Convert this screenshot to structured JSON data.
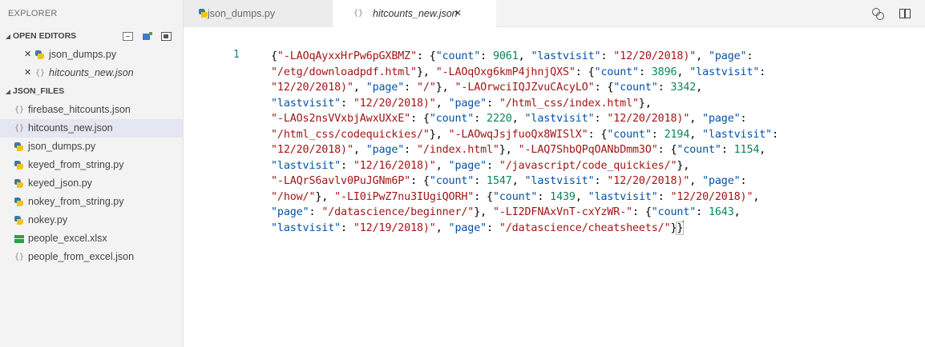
{
  "sidebar": {
    "title": "EXPLORER",
    "open_editors": {
      "label": "OPEN EDITORS",
      "items": [
        {
          "label": "json_dumps.py",
          "icon": "python-icon"
        },
        {
          "label": "hitcounts_new.json",
          "icon": "json-icon"
        }
      ]
    },
    "folder": {
      "label": "JSON_FILES",
      "items": [
        {
          "label": "firebase_hitcounts.json",
          "icon": "json-icon"
        },
        {
          "label": "hitcounts_new.json",
          "icon": "json-icon"
        },
        {
          "label": "json_dumps.py",
          "icon": "python-icon"
        },
        {
          "label": "keyed_from_string.py",
          "icon": "python-icon"
        },
        {
          "label": "keyed_json.py",
          "icon": "python-icon"
        },
        {
          "label": "nokey_from_string.py",
          "icon": "python-icon"
        },
        {
          "label": "nokey.py",
          "icon": "python-icon"
        },
        {
          "label": "people_excel.xlsx",
          "icon": "excel-icon"
        },
        {
          "label": "people_from_excel.json",
          "icon": "json-icon"
        }
      ]
    }
  },
  "tabs": [
    {
      "label": "json_dumps.py",
      "active": false
    },
    {
      "label": "hitcounts_new.json",
      "active": true,
      "close": "✕"
    }
  ],
  "editor": {
    "line_number": "1",
    "lines": [
      [
        [
          "p",
          "{"
        ],
        [
          "s",
          "\"-LAOqAyxxHrPw6pGXBMZ\""
        ],
        [
          "p",
          ": {"
        ],
        [
          "k",
          "\"count\""
        ],
        [
          "p",
          ": "
        ],
        [
          "n",
          "9061"
        ],
        [
          "p",
          ", "
        ],
        [
          "k",
          "\"lastvisit\""
        ],
        [
          "p",
          ": "
        ],
        [
          "s",
          "\"12/20/2018)\""
        ],
        [
          "p",
          ", "
        ],
        [
          "k",
          "\"page\""
        ],
        [
          "p",
          ":"
        ]
      ],
      [
        [
          "s",
          "\"/etg/downloadpdf.html\""
        ],
        [
          "p",
          "}, "
        ],
        [
          "s",
          "\"-LAOqOxg6kmP4jhnjQXS\""
        ],
        [
          "p",
          ": {"
        ],
        [
          "k",
          "\"count\""
        ],
        [
          "p",
          ": "
        ],
        [
          "n",
          "3896"
        ],
        [
          "p",
          ", "
        ],
        [
          "k",
          "\"lastvisit\""
        ],
        [
          "p",
          ":"
        ]
      ],
      [
        [
          "s",
          "\"12/20/2018)\""
        ],
        [
          "p",
          ", "
        ],
        [
          "k",
          "\"page\""
        ],
        [
          "p",
          ": "
        ],
        [
          "s",
          "\"/\""
        ],
        [
          "p",
          "}, "
        ],
        [
          "s",
          "\"-LAOrwciIQJZvuCAcyLO\""
        ],
        [
          "p",
          ": {"
        ],
        [
          "k",
          "\"count\""
        ],
        [
          "p",
          ": "
        ],
        [
          "n",
          "3342"
        ],
        [
          "p",
          ","
        ]
      ],
      [
        [
          "k",
          "\"lastvisit\""
        ],
        [
          "p",
          ": "
        ],
        [
          "s",
          "\"12/20/2018)\""
        ],
        [
          "p",
          ", "
        ],
        [
          "k",
          "\"page\""
        ],
        [
          "p",
          ": "
        ],
        [
          "s",
          "\"/html_css/index.html\""
        ],
        [
          "p",
          "},"
        ]
      ],
      [
        [
          "s",
          "\"-LAOs2nsVVxbjAwxUXxE\""
        ],
        [
          "p",
          ": {"
        ],
        [
          "k",
          "\"count\""
        ],
        [
          "p",
          ": "
        ],
        [
          "n",
          "2220"
        ],
        [
          "p",
          ", "
        ],
        [
          "k",
          "\"lastvisit\""
        ],
        [
          "p",
          ": "
        ],
        [
          "s",
          "\"12/20/2018)\""
        ],
        [
          "p",
          ", "
        ],
        [
          "k",
          "\"page\""
        ],
        [
          "p",
          ":"
        ]
      ],
      [
        [
          "s",
          "\"/html_css/codequickies/\""
        ],
        [
          "p",
          "}, "
        ],
        [
          "s",
          "\"-LAOwqJsjfuoQx8WISlX\""
        ],
        [
          "p",
          ": {"
        ],
        [
          "k",
          "\"count\""
        ],
        [
          "p",
          ": "
        ],
        [
          "n",
          "2194"
        ],
        [
          "p",
          ", "
        ],
        [
          "k",
          "\"lastvisit\""
        ],
        [
          "p",
          ":"
        ]
      ],
      [
        [
          "s",
          "\"12/20/2018)\""
        ],
        [
          "p",
          ", "
        ],
        [
          "k",
          "\"page\""
        ],
        [
          "p",
          ": "
        ],
        [
          "s",
          "\"/index.html\""
        ],
        [
          "p",
          "}, "
        ],
        [
          "s",
          "\"-LAQ7ShbQPqOANbDmm3O\""
        ],
        [
          "p",
          ": {"
        ],
        [
          "k",
          "\"count\""
        ],
        [
          "p",
          ": "
        ],
        [
          "n",
          "1154"
        ],
        [
          "p",
          ","
        ]
      ],
      [
        [
          "k",
          "\"lastvisit\""
        ],
        [
          "p",
          ": "
        ],
        [
          "s",
          "\"12/16/2018)\""
        ],
        [
          "p",
          ", "
        ],
        [
          "k",
          "\"page\""
        ],
        [
          "p",
          ": "
        ],
        [
          "s",
          "\"/javascript/code_quickies/\""
        ],
        [
          "p",
          "},"
        ]
      ],
      [
        [
          "s",
          "\"-LAQrS6avlv0PuJGNm6P\""
        ],
        [
          "p",
          ": {"
        ],
        [
          "k",
          "\"count\""
        ],
        [
          "p",
          ": "
        ],
        [
          "n",
          "1547"
        ],
        [
          "p",
          ", "
        ],
        [
          "k",
          "\"lastvisit\""
        ],
        [
          "p",
          ": "
        ],
        [
          "s",
          "\"12/20/2018)\""
        ],
        [
          "p",
          ", "
        ],
        [
          "k",
          "\"page\""
        ],
        [
          "p",
          ":"
        ]
      ],
      [
        [
          "s",
          "\"/how/\""
        ],
        [
          "p",
          "}, "
        ],
        [
          "s",
          "\"-LI0iPwZ7nu3IUgiQORH\""
        ],
        [
          "p",
          ": {"
        ],
        [
          "k",
          "\"count\""
        ],
        [
          "p",
          ": "
        ],
        [
          "n",
          "1439"
        ],
        [
          "p",
          ", "
        ],
        [
          "k",
          "\"lastvisit\""
        ],
        [
          "p",
          ": "
        ],
        [
          "s",
          "\"12/20/2018)\""
        ],
        [
          "p",
          ","
        ]
      ],
      [
        [
          "k",
          "\"page\""
        ],
        [
          "p",
          ": "
        ],
        [
          "s",
          "\"/datascience/beginner/\""
        ],
        [
          "p",
          "}, "
        ],
        [
          "s",
          "\"-LI2DFNAxVnT-cxYzWR-\""
        ],
        [
          "p",
          ": {"
        ],
        [
          "k",
          "\"count\""
        ],
        [
          "p",
          ": "
        ],
        [
          "n",
          "1643"
        ],
        [
          "p",
          ","
        ]
      ],
      [
        [
          "k",
          "\"lastvisit\""
        ],
        [
          "p",
          ": "
        ],
        [
          "s",
          "\"12/19/2018)\""
        ],
        [
          "p",
          ", "
        ],
        [
          "k",
          "\"page\""
        ],
        [
          "p",
          ": "
        ],
        [
          "s",
          "\"/datascience/cheatsheets/\""
        ],
        [
          "p",
          "}"
        ],
        [
          "b",
          "}"
        ]
      ]
    ]
  },
  "colors": {
    "string": "#a31515",
    "key": "#0451a5",
    "number": "#098658",
    "punct": "#000000",
    "line_number": "#237893",
    "selected_row": "#e4e6f1"
  }
}
